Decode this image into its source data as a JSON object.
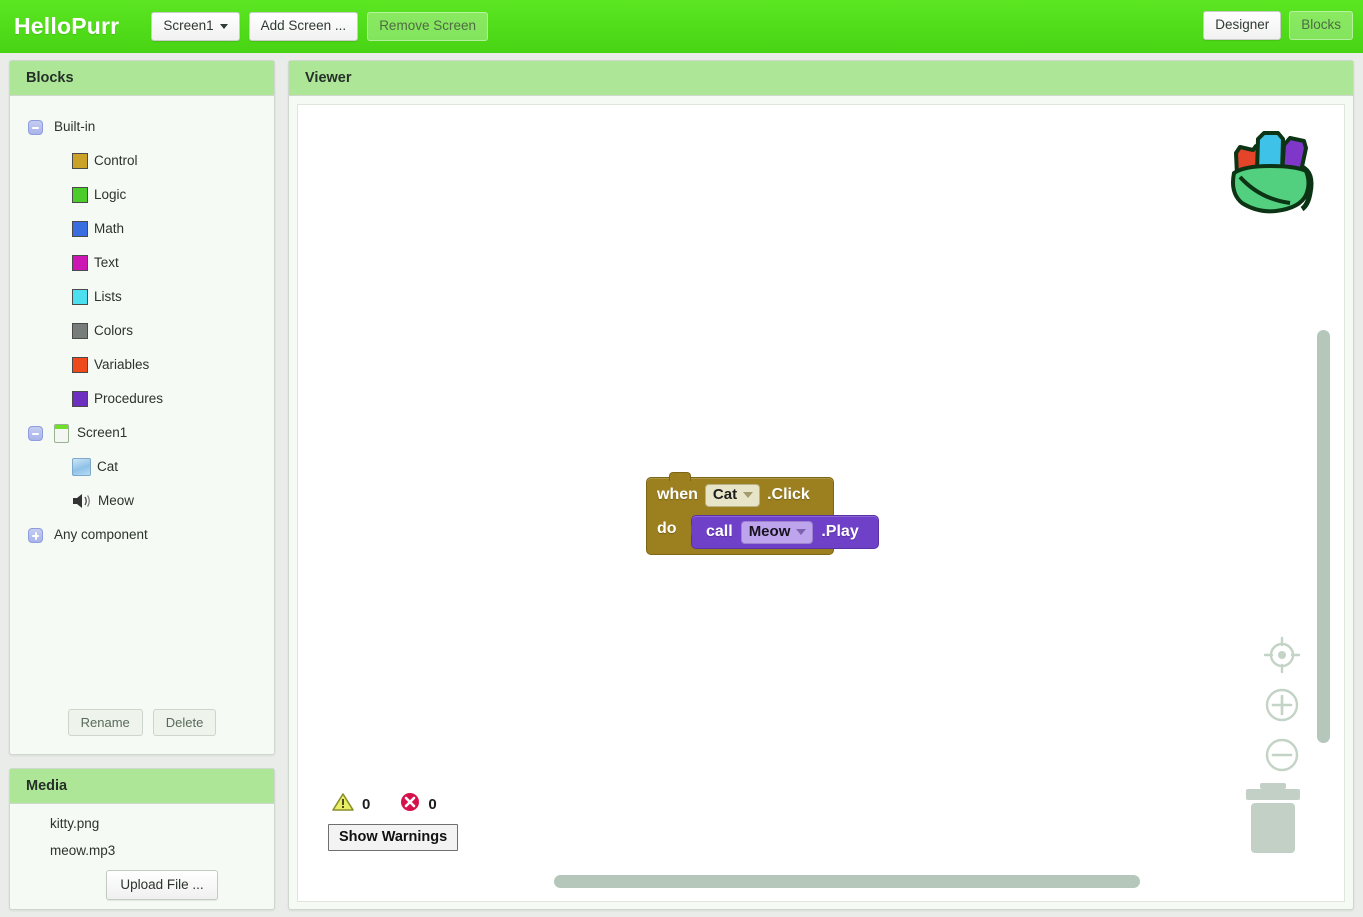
{
  "topbar": {
    "app_title": "HelloPurr",
    "screen_selector": "Screen1",
    "add_screen": "Add Screen ...",
    "remove_screen": "Remove Screen",
    "designer": "Designer",
    "blocks": "Blocks",
    "bar_color": "#54e01b"
  },
  "blocks_panel": {
    "title": "Blocks",
    "tree": [
      {
        "label": "Built-in",
        "type": "group",
        "toggle": "minus"
      },
      {
        "label": "Control",
        "type": "swatch",
        "color": "#c9a227"
      },
      {
        "label": "Logic",
        "type": "swatch",
        "color": "#4ccc2a"
      },
      {
        "label": "Math",
        "type": "swatch",
        "color": "#3a6ee0"
      },
      {
        "label": "Text",
        "type": "swatch",
        "color": "#cc17b5"
      },
      {
        "label": "Lists",
        "type": "swatch",
        "color": "#4bdff0"
      },
      {
        "label": "Colors",
        "type": "swatch",
        "color": "#767d7a"
      },
      {
        "label": "Variables",
        "type": "swatch",
        "color": "#ee4a1c"
      },
      {
        "label": "Procedures",
        "type": "swatch",
        "color": "#6c2fc0"
      },
      {
        "label": "Screen1",
        "type": "screen",
        "toggle": "minus"
      },
      {
        "label": "Cat",
        "type": "image"
      },
      {
        "label": "Meow",
        "type": "sound"
      },
      {
        "label": "Any component",
        "type": "group",
        "toggle": "plus"
      }
    ],
    "rename": "Rename",
    "delete": "Delete"
  },
  "media_panel": {
    "title": "Media",
    "files": [
      "kitty.png",
      "meow.mp3"
    ],
    "upload": "Upload File ..."
  },
  "viewer": {
    "title": "Viewer",
    "backpack_icon": "backpack-icon",
    "trash_icon": "trash-icon",
    "zoom_controls": [
      {
        "icon": "center-target-icon"
      },
      {
        "icon": "zoom-in-icon",
        "glyph": "+"
      },
      {
        "icon": "zoom-out-icon",
        "glyph": "−"
      }
    ],
    "blocks": {
      "event": {
        "keyword": "when",
        "component": "Cat",
        "event_name": ".Click",
        "body_label": "do",
        "color": "#9c8020"
      },
      "call": {
        "keyword": "call",
        "component": "Meow",
        "method_name": ".Play",
        "color": "#6f41c9"
      }
    },
    "warnings": {
      "warning_count": "0",
      "error_count": "0",
      "show_warnings": "Show Warnings",
      "warning_color": "#e8ef64",
      "error_color": "#d6104a"
    }
  }
}
